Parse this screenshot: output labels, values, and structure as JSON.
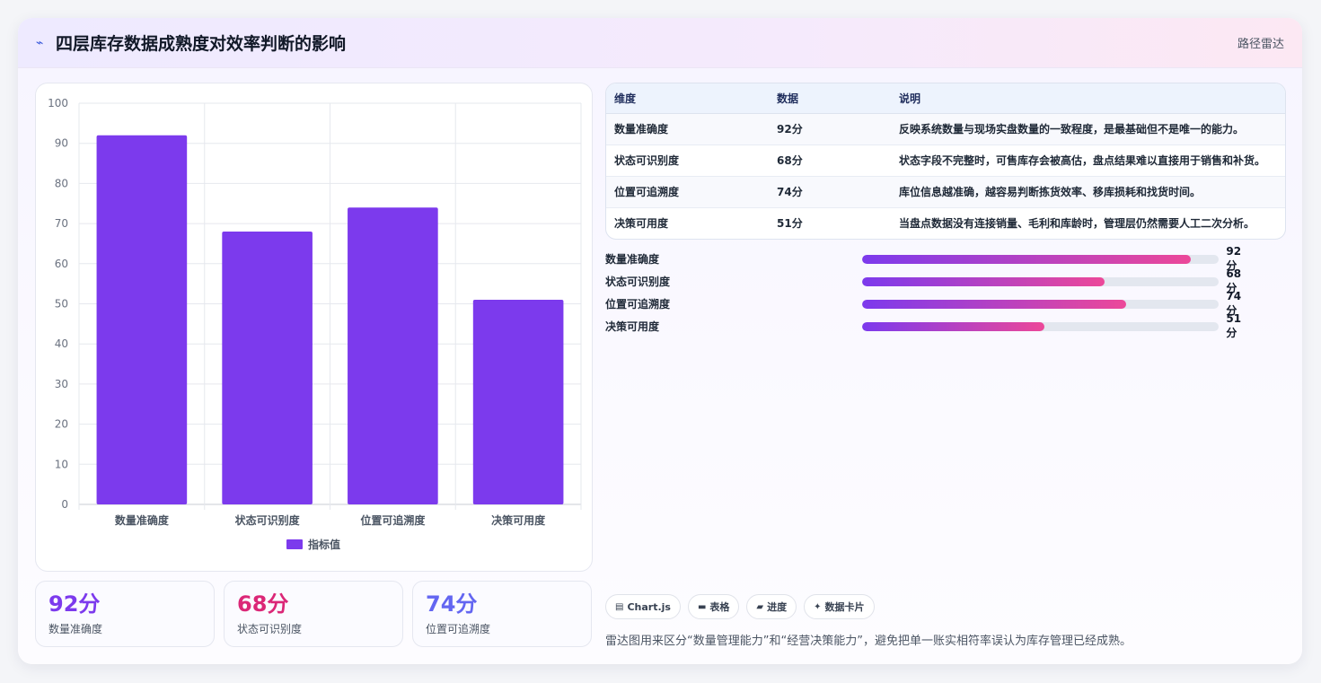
{
  "header": {
    "title": "四层库存数据成熟度对效率判断的影响",
    "tag": "路径雷达",
    "icon": "lightning-icon"
  },
  "chart_data": {
    "type": "bar",
    "categories": [
      "数量准确度",
      "状态可识别度",
      "位置可追溯度",
      "决策可用度"
    ],
    "series": [
      {
        "name": "指标值",
        "values": [
          92,
          68,
          74,
          51
        ],
        "color": "#7c3aed"
      }
    ],
    "ylim": [
      0,
      100
    ],
    "yticks": [
      0,
      10,
      20,
      30,
      40,
      50,
      60,
      70,
      80,
      90,
      100
    ],
    "grid": true,
    "legend_position": "bottom",
    "title": "",
    "xlabel": "",
    "ylabel": ""
  },
  "stats": [
    {
      "value": "92分",
      "label": "数量准确度",
      "color": "#7c3aed"
    },
    {
      "value": "68分",
      "label": "状态可识别度",
      "color": "#db2777"
    },
    {
      "value": "74分",
      "label": "位置可追溯度",
      "color": "#6366f1"
    }
  ],
  "table": {
    "headers": [
      "维度",
      "数据",
      "说明"
    ],
    "rows": [
      [
        "数量准确度",
        "92分",
        "反映系统数量与现场实盘数量的一致程度，是最基础但不是唯一的能力。"
      ],
      [
        "状态可识别度",
        "68分",
        "状态字段不完整时，可售库存会被高估，盘点结果难以直接用于销售和补货。"
      ],
      [
        "位置可追溯度",
        "74分",
        "库位信息越准确，越容易判断拣货效率、移库损耗和找货时间。"
      ],
      [
        "决策可用度",
        "51分",
        "当盘点数据没有连接销量、毛利和库龄时，管理层仍然需要人工二次分析。"
      ]
    ]
  },
  "progress": [
    {
      "label": "数量准确度",
      "value": "92分",
      "level": 0.92
    },
    {
      "label": "状态可识别度",
      "value": "68分",
      "level": 0.68
    },
    {
      "label": "位置可追溯度",
      "value": "74分",
      "level": 0.74
    },
    {
      "label": "决策可用度",
      "value": "51分",
      "level": 0.51
    }
  ],
  "chips": [
    {
      "icon": "chart-icon",
      "glyph": "▤",
      "label": "Chart.js"
    },
    {
      "icon": "table-icon",
      "glyph": "▬",
      "label": "表格"
    },
    {
      "icon": "progress-icon",
      "glyph": "▰",
      "label": "进度"
    },
    {
      "icon": "card-icon",
      "glyph": "✦",
      "label": "数据卡片"
    }
  ],
  "note": "雷达图用来区分“数量管理能力”和“经营决策能力”，避免把单一账实相符率误认为库存管理已经成熟。"
}
